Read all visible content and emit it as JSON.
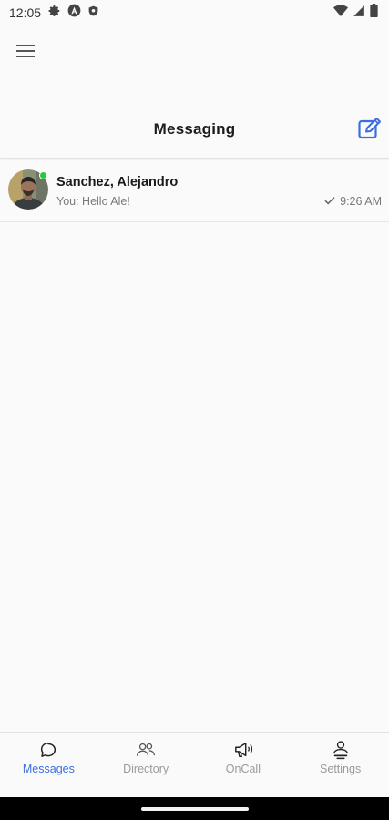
{
  "status_bar": {
    "time": "12:05",
    "left_icons": [
      "gear-icon",
      "a-badge-icon",
      "shield-icon"
    ],
    "right_icons": [
      "wifi-icon",
      "cell-signal-icon",
      "battery-icon"
    ]
  },
  "header": {
    "menu_icon": "hamburger-menu-icon",
    "title": "Messaging",
    "compose_icon": "compose-icon"
  },
  "conversations": [
    {
      "name": "Sanchez, Alejandro",
      "preview": "You: Hello Ale!",
      "time": "9:26 AM",
      "status_icon": "check-icon",
      "online": true
    }
  ],
  "bottom_nav": {
    "items": [
      {
        "label": "Messages",
        "icon": "chat-bubble-icon",
        "active": true
      },
      {
        "label": "Directory",
        "icon": "people-icon",
        "active": false
      },
      {
        "label": "OnCall",
        "icon": "megaphone-icon",
        "active": false
      },
      {
        "label": "Settings",
        "icon": "user-settings-icon",
        "active": false
      }
    ]
  },
  "colors": {
    "accent": "#3b6fe0",
    "background": "#fafafa",
    "online": "#28c840",
    "muted_text": "#7a7a7a"
  }
}
